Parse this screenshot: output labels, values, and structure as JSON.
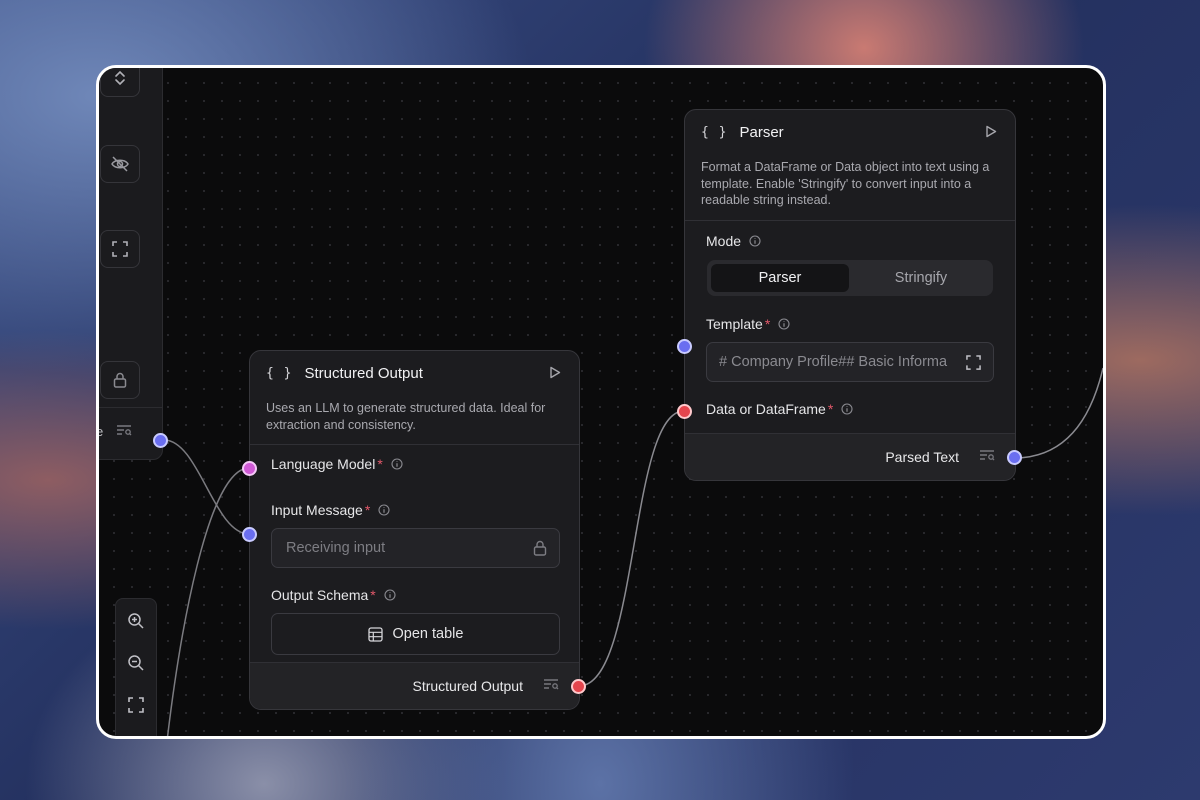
{
  "structured_output": {
    "title": "Structured Output",
    "description": "Uses an LLM to generate structured data. Ideal for extraction and consistency.",
    "fields": {
      "language_model": "Language Model",
      "input_message": "Input Message",
      "output_schema": "Output Schema"
    },
    "input_placeholder": "Receiving input",
    "open_table_label": "Open table",
    "output_label": "Structured Output"
  },
  "parser": {
    "title": "Parser",
    "description": "Format a DataFrame or Data object into text using a template. Enable 'Stringify' to convert input into a readable string instead.",
    "mode_label": "Mode",
    "mode_options": [
      "Parser",
      "Stringify"
    ],
    "mode_selected": "Parser",
    "template_label": "Template",
    "template_value": "# Company Profile## Basic Informa",
    "data_label": "Data or DataFrame",
    "output_label": "Parsed Text"
  },
  "required_marker": "*",
  "sidebar": {
    "footer_fragment": "e"
  },
  "icons": {
    "brace": "{ }",
    "play": "play-icon",
    "info": "info-icon",
    "lock": "lock-icon",
    "expand": "expand-icon",
    "table": "table-icon",
    "output_inspect": "list-search-icon",
    "zoom_in": "zoom-in-icon",
    "zoom_out": "zoom-out-icon",
    "fit_view": "fit-view-icon",
    "eye_off": "eye-off-icon",
    "chevrons": "chevron-up-down-icon"
  },
  "colors": {
    "canvas": "#0b0b0c",
    "node_bg": "#1c1c1f",
    "handle_blue": "#6a6ef0",
    "handle_red": "#e5454d",
    "handle_pink": "#d05ad6",
    "required": "#e2586a"
  }
}
